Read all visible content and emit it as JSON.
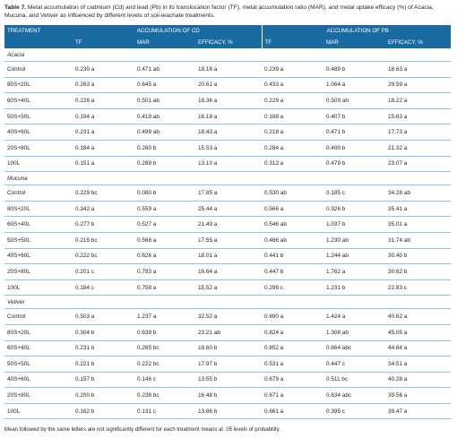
{
  "caption": {
    "label": "Table 7.",
    "text": "Metal accumulation of cadmium (Cd) and lead (Pb) in its translocation factor (TF), metal accumulation ratio (MAR), and metal uptake efficacy (%) of Acacia, Mucuna, and Vetiver as influenced by different levels of soil-leachate treatments."
  },
  "header": {
    "treatment": "TREATMENT",
    "group_cd": "ACCUMULATION OF CD",
    "group_pb": "ACCUMULATION OF PB",
    "sub": [
      "TF",
      "MAR",
      "EFFICACY, %",
      "TF",
      "MAR",
      "EFFICACY, %"
    ]
  },
  "groups": [
    {
      "name": "Acacia",
      "rows": [
        [
          "Control",
          "0.230 a",
          "0.471 ab",
          "18.16 a",
          "0.239 a",
          "0.489 b",
          "18.63 a"
        ],
        [
          "80S+20L",
          "0.263 a",
          "0.645 a",
          "20.61 a",
          "0.433 a",
          "1.064 a",
          "29.59 a"
        ],
        [
          "60S+40L",
          "0.226 a",
          "0.501 ab",
          "18.36 a",
          "0.229 a",
          "0.509 ab",
          "18.22 a"
        ],
        [
          "50S+50L",
          "0.194 a",
          "0.419 ab",
          "16.18 a",
          "0.188 a",
          "0.407 b",
          "15.63 a"
        ],
        [
          "40S+60L",
          "0.231 a",
          "0.499 ab",
          "18.43 a",
          "0.218 a",
          "0.471 b",
          "17.73 a"
        ],
        [
          "20S+80L",
          "0.184 a",
          "0.260 b",
          "15.53 a",
          "0.284 a",
          "0.400 b",
          "21.32 a"
        ],
        [
          "100L",
          "0.151 a",
          "0.289 b",
          "13.10 a",
          "0.312 a",
          "0.479 b",
          "23.07 a"
        ]
      ]
    },
    {
      "name": "Mucuna",
      "rows": [
        [
          "Control",
          "0.229 bc",
          "0.080 b",
          "17.85 a",
          "0.530 ab",
          "0.185 c",
          "34.28 ab"
        ],
        [
          "80S+20L",
          "0.342 a",
          "0.559 a",
          "25.44 a",
          "0.566 a",
          "0.926 b",
          "35.41 a"
        ],
        [
          "60S+40L",
          "0.277 b",
          "0.527 a",
          "21.49 a",
          "0.546 ab",
          "1.037 b",
          "35.01 a"
        ],
        [
          "50S+50L",
          "0.215 bc",
          "0.568 a",
          "17.55 a",
          "0.466 ab",
          "1.230 ab",
          "31.74 ab"
        ],
        [
          "40S+60L",
          "0.222 bc",
          "0.626 a",
          "18.01 a",
          "0.441 b",
          "1.244 ab",
          "30.40 b"
        ],
        [
          "20S+80L",
          "0.201 c",
          "0.793 a",
          "16.64 a",
          "0.447 b",
          "1.762 a",
          "30.62 b"
        ],
        [
          "100L",
          "0.184 c",
          "0.758 a",
          "15.52 a",
          "0.299 c",
          "1.231 b",
          "22.83 c"
        ]
      ]
    },
    {
      "name": "Vetiver",
      "rows": [
        [
          "Control",
          "0.503 a",
          "1.237 a",
          "32.52 a",
          "0.690 a",
          "1.424 a",
          "40.62 a"
        ],
        [
          "80S+20L",
          "0.304 b",
          "0.639 b",
          "23.21 ab",
          "0.824 a",
          "1.308 ab",
          "45.05 a"
        ],
        [
          "60S+40L",
          "0.231 b",
          "0.265 bc",
          "18.60 b",
          "0.852 a",
          "0.664 abc",
          "44.84 a"
        ],
        [
          "50S+50L",
          "0.221 b",
          "0.222 bc",
          "17.97 b",
          "0.531 a",
          "0.447 c",
          "34.51 a"
        ],
        [
          "40S+60L",
          "0.157 b",
          "0.146 c",
          "13.55 b",
          "0.679 a",
          "0.511 bc",
          "40.28 a"
        ],
        [
          "20S+80L",
          "0.200 b",
          "0.238 bc",
          "16.48 b",
          "0.671 a",
          "0.634 abc",
          "39.56 a"
        ],
        [
          "100L",
          "0.162 b",
          "0.131 c",
          "13.86 b",
          "0.661 a",
          "0.395 c",
          "39.47 a"
        ]
      ]
    }
  ],
  "footnote": "Mean followed by the same letters are not significantly different for each treatment means at .05 levels of probability.",
  "colors": {
    "header_bg": "#1a6aa2",
    "rule": "#8ec3e3"
  }
}
